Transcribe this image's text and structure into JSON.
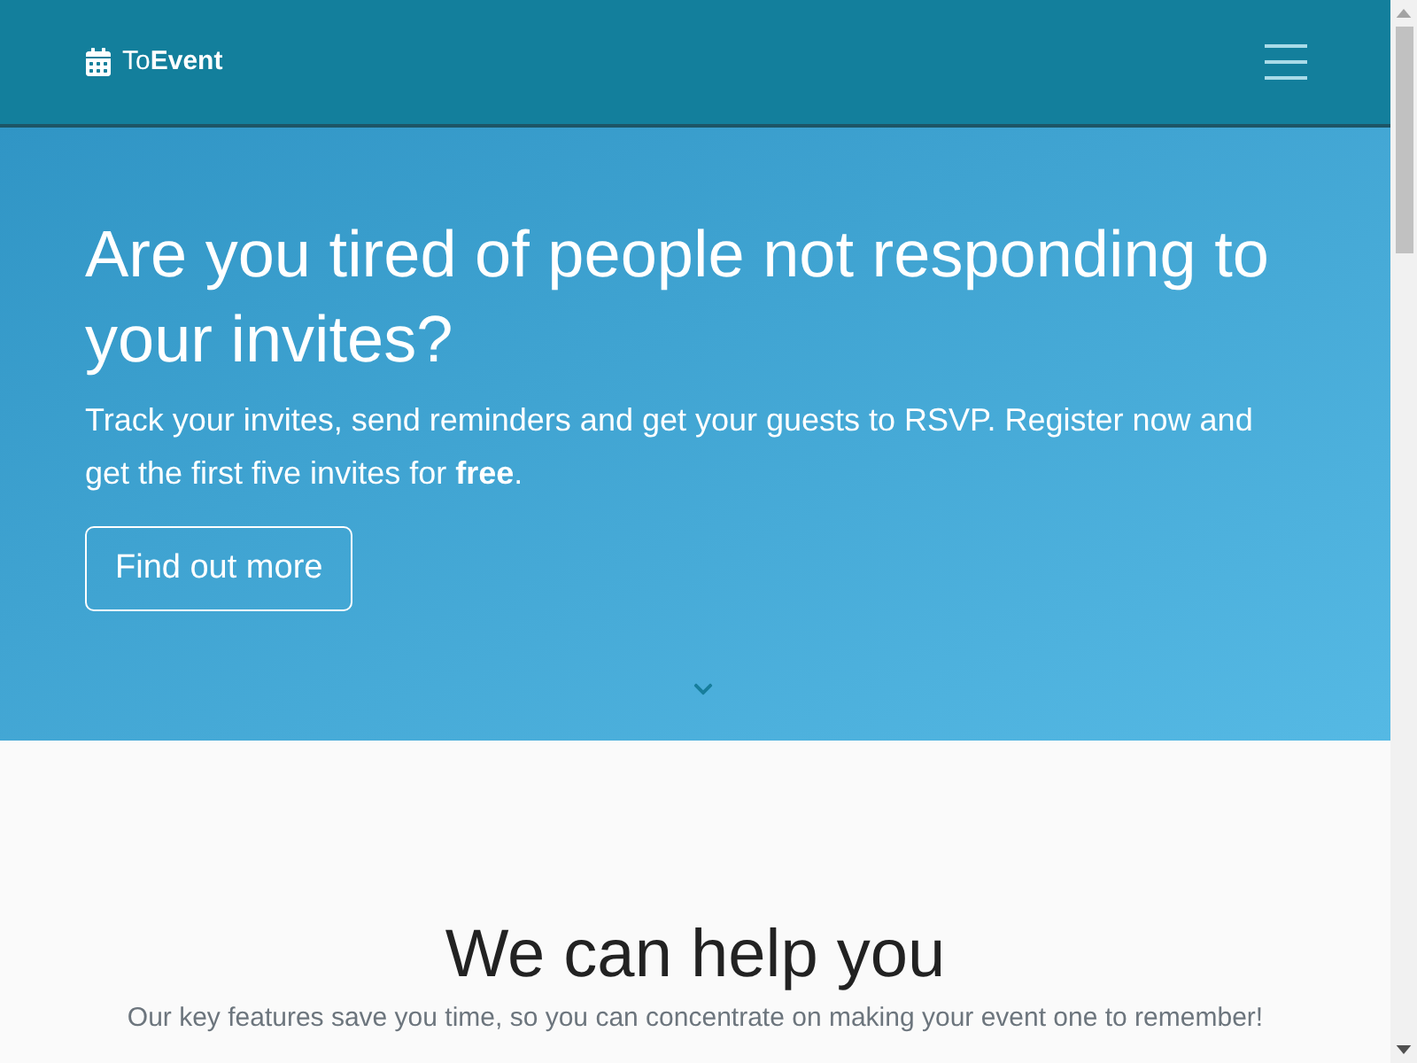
{
  "navbar": {
    "brand": "To**Event**"
  },
  "hero": {
    "heading": "Are you tired of people not responding to your invites?",
    "text": "Track your invites, send reminders and get your guests to RSVP. Register now and get the first five invites for **free**.",
    "button": "Find out more"
  },
  "features": {
    "heading": "We can help you",
    "text": "Our key features save you time, so you can concentrate on making your event one to remember!"
  }
}
